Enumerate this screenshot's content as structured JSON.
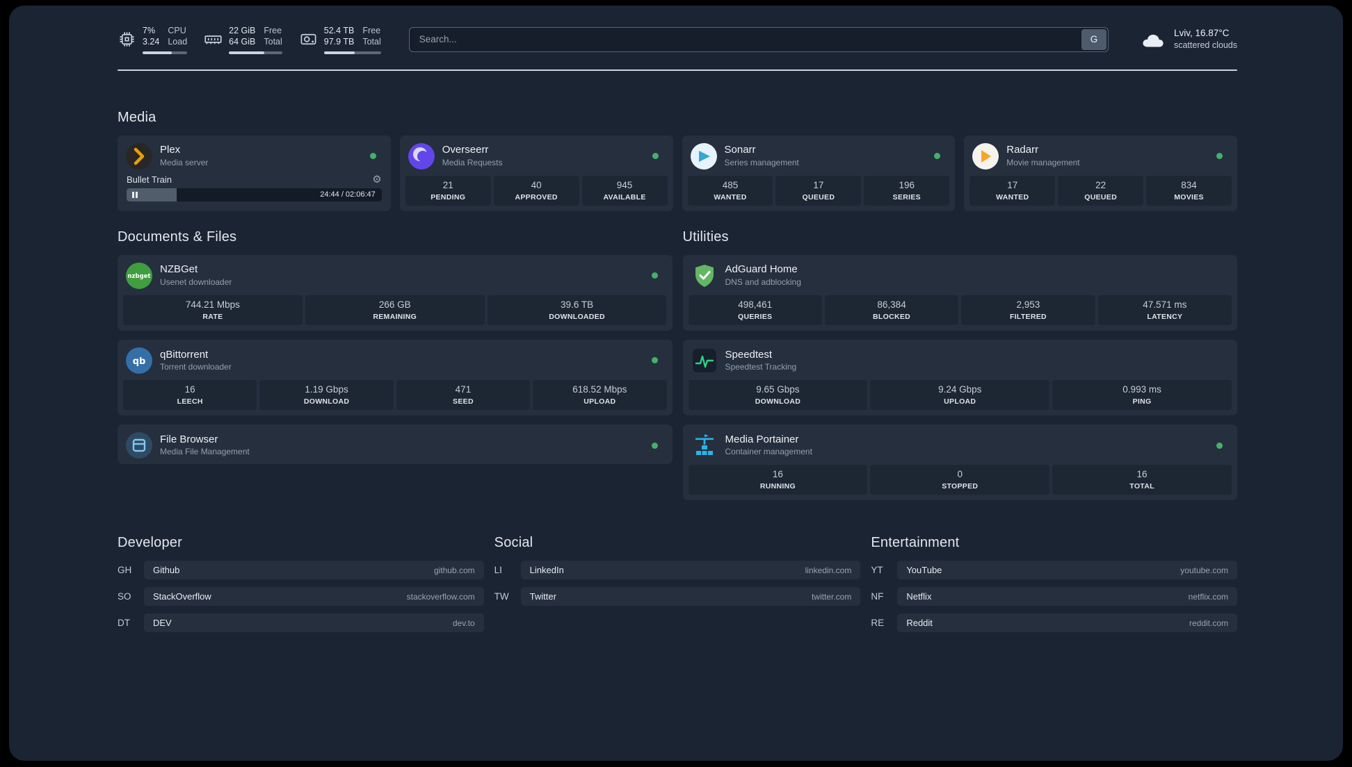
{
  "topbar": {
    "cpu": {
      "icon": "cpu-icon",
      "percent": "7%",
      "load": "3.24",
      "labels": [
        "CPU",
        "Load"
      ],
      "bar": "66%"
    },
    "memory": {
      "icon": "memory-icon",
      "free": "22 GiB",
      "total": "64 GiB",
      "labels": [
        "Free",
        "Total"
      ],
      "bar": "66%"
    },
    "disk": {
      "icon": "disk-icon",
      "free": "52.4 TB",
      "total": "97.9 TB",
      "labels": [
        "Free",
        "Total"
      ],
      "bar": "54%"
    },
    "search": {
      "placeholder": "Search...",
      "provider_label": "G"
    },
    "weather": {
      "icon": "cloud-icon",
      "location": "Lviv, 16.87°C",
      "condition": "scattered clouds"
    }
  },
  "media": {
    "title": "Media",
    "cards": [
      {
        "icon": "plex-icon",
        "name": "Plex",
        "desc": "Media server",
        "status": "online",
        "player": {
          "track": "Bullet Train",
          "time": "24:44 / 02:06:47",
          "progress": "19.5%"
        }
      },
      {
        "icon": "overseerr-icon",
        "name": "Overseerr",
        "desc": "Media Requests",
        "status": "online",
        "stats": [
          {
            "value": "21",
            "label": "PENDING"
          },
          {
            "value": "40",
            "label": "APPROVED"
          },
          {
            "value": "945",
            "label": "AVAILABLE"
          }
        ]
      },
      {
        "icon": "sonarr-icon",
        "name": "Sonarr",
        "desc": "Series management",
        "status": "online",
        "stats": [
          {
            "value": "485",
            "label": "WANTED"
          },
          {
            "value": "17",
            "label": "QUEUED"
          },
          {
            "value": "196",
            "label": "SERIES"
          }
        ]
      },
      {
        "icon": "radarr-icon",
        "name": "Radarr",
        "desc": "Movie management",
        "status": "online",
        "stats": [
          {
            "value": "17",
            "label": "WANTED"
          },
          {
            "value": "22",
            "label": "QUEUED"
          },
          {
            "value": "834",
            "label": "MOVIES"
          }
        ]
      }
    ]
  },
  "documents": {
    "title": "Documents & Files",
    "cards": [
      {
        "icon": "nzbget-icon",
        "name": "NZBGet",
        "desc": "Usenet downloader",
        "status": "online",
        "stats": [
          {
            "value": "744.21 Mbps",
            "label": "RATE"
          },
          {
            "value": "266 GB",
            "label": "REMAINING"
          },
          {
            "value": "39.6 TB",
            "label": "DOWNLOADED"
          }
        ]
      },
      {
        "icon": "qbittorrent-icon",
        "name": "qBittorrent",
        "desc": "Torrent downloader",
        "status": "online",
        "stats": [
          {
            "value": "16",
            "label": "LEECH"
          },
          {
            "value": "1.19 Gbps",
            "label": "DOWNLOAD"
          },
          {
            "value": "471",
            "label": "SEED"
          },
          {
            "value": "618.52 Mbps",
            "label": "UPLOAD"
          }
        ]
      },
      {
        "icon": "filebrowser-icon",
        "name": "File Browser",
        "desc": "Media File Management",
        "status": "online"
      }
    ]
  },
  "utilities": {
    "title": "Utilities",
    "cards": [
      {
        "icon": "adguard-icon",
        "name": "AdGuard Home",
        "desc": "DNS and adblocking",
        "stats": [
          {
            "value": "498,461",
            "label": "QUERIES"
          },
          {
            "value": "86,384",
            "label": "BLOCKED"
          },
          {
            "value": "2,953",
            "label": "FILTERED"
          },
          {
            "value": "47.571 ms",
            "label": "LATENCY"
          }
        ]
      },
      {
        "icon": "speedtest-icon",
        "name": "Speedtest",
        "desc": "Speedtest Tracking",
        "stats": [
          {
            "value": "9.65 Gbps",
            "label": "DOWNLOAD"
          },
          {
            "value": "9.24 Gbps",
            "label": "UPLOAD"
          },
          {
            "value": "0.993 ms",
            "label": "PING"
          }
        ]
      },
      {
        "icon": "portainer-icon",
        "name": "Media Portainer",
        "desc": "Container management",
        "status": "online",
        "stats": [
          {
            "value": "16",
            "label": "RUNNING"
          },
          {
            "value": "0",
            "label": "STOPPED"
          },
          {
            "value": "16",
            "label": "TOTAL"
          }
        ]
      }
    ]
  },
  "bookmarks": {
    "groups": [
      {
        "title": "Developer",
        "items": [
          {
            "abbr": "GH",
            "name": "Github",
            "url": "github.com"
          },
          {
            "abbr": "SO",
            "name": "StackOverflow",
            "url": "stackoverflow.com"
          },
          {
            "abbr": "DT",
            "name": "DEV",
            "url": "dev.to"
          }
        ]
      },
      {
        "title": "Social",
        "items": [
          {
            "abbr": "LI",
            "name": "LinkedIn",
            "url": "linkedin.com"
          },
          {
            "abbr": "TW",
            "name": "Twitter",
            "url": "twitter.com"
          }
        ]
      },
      {
        "title": "Entertainment",
        "items": [
          {
            "abbr": "YT",
            "name": "YouTube",
            "url": "youtube.com"
          },
          {
            "abbr": "NF",
            "name": "Netflix",
            "url": "netflix.com"
          },
          {
            "abbr": "RE",
            "name": "Reddit",
            "url": "reddit.com"
          }
        ]
      }
    ]
  },
  "colors": {
    "status_online": "#44b168",
    "page_bg": "#1b2433",
    "card_bg": "#252f3e",
    "stat_bg": "#1d2633",
    "plex": "#e5a00d",
    "overseerr": "#6246ea",
    "sonarr": "#35a7d9",
    "radarr": "#f8a529",
    "nzbget": "#3f9e3f",
    "qbittorrent": "#356fa8",
    "adguard": "#63b663",
    "speedtest": "#2fd083",
    "portainer": "#2bb3e4"
  }
}
